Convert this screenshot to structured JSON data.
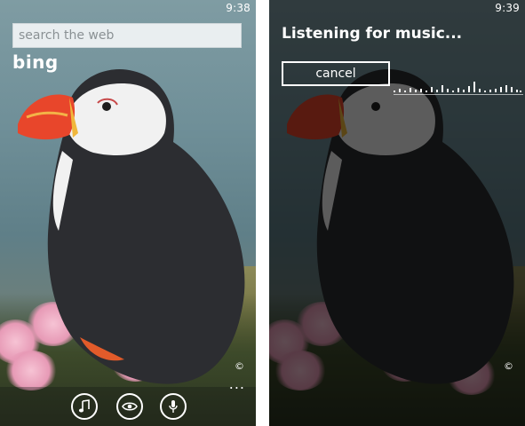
{
  "left": {
    "status_time": "9:38",
    "search": {
      "placeholder": "search the web"
    },
    "logo_text": "bing",
    "copyright": "©",
    "app_bar": {
      "buttons": [
        "music-icon",
        "eye-icon",
        "microphone-icon"
      ],
      "more": "..."
    }
  },
  "right": {
    "status_time": "9:39",
    "title": "Listening for music...",
    "cancel_label": "cancel",
    "copyright": "©"
  },
  "colors": {
    "puffin_beak": "#e8462b",
    "search_bg": "#e9eef0",
    "dim_overlay": "#000000"
  }
}
